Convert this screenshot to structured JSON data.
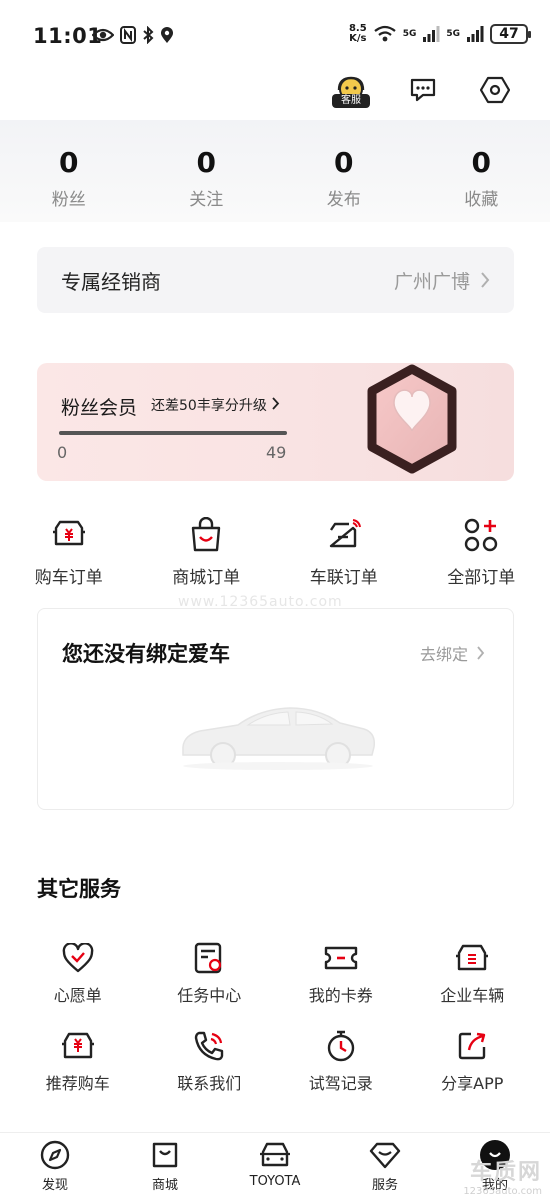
{
  "status": {
    "time": "11:01",
    "net_speed_top": "8.5",
    "net_speed_bottom": "K/s",
    "signal1": "5G",
    "signal2": "5G",
    "battery": "47"
  },
  "header": {
    "kefu_label": "客服"
  },
  "stats": [
    {
      "value": "0",
      "label": "粉丝"
    },
    {
      "value": "0",
      "label": "关注"
    },
    {
      "value": "0",
      "label": "发布"
    },
    {
      "value": "0",
      "label": "收藏"
    }
  ],
  "dealer": {
    "label": "专属经销商",
    "value": "广州广博"
  },
  "membership": {
    "title": "粉丝会员",
    "hint": "还差50丰享分升级",
    "min": "0",
    "max": "49",
    "progress_fraction": 1.0
  },
  "orders": [
    {
      "label": "购车订单",
      "icon": "car-yuan-icon"
    },
    {
      "label": "商城订单",
      "icon": "shopping-bag-icon"
    },
    {
      "label": "车联订单",
      "icon": "connected-car-icon"
    },
    {
      "label": "全部订单",
      "icon": "all-orders-icon"
    }
  ],
  "watermark": "www.12365auto.com",
  "car_binding": {
    "title": "您还没有绑定爱车",
    "action": "去绑定"
  },
  "services": {
    "title": "其它服务",
    "items": [
      {
        "label": "心愿单",
        "icon": "heart-check-icon"
      },
      {
        "label": "任务中心",
        "icon": "task-icon"
      },
      {
        "label": "我的卡券",
        "icon": "coupon-icon"
      },
      {
        "label": "企业车辆",
        "icon": "enterprise-car-icon"
      },
      {
        "label": "推荐购车",
        "icon": "recommend-car-icon"
      },
      {
        "label": "联系我们",
        "icon": "phone-icon"
      },
      {
        "label": "试驾记录",
        "icon": "stopwatch-icon"
      },
      {
        "label": "分享APP",
        "icon": "share-icon"
      }
    ]
  },
  "nav": [
    {
      "label": "发现",
      "icon": "compass-icon"
    },
    {
      "label": "商城",
      "icon": "bag-icon"
    },
    {
      "label": "TOYOTA",
      "icon": "car-front-icon"
    },
    {
      "label": "服务",
      "icon": "diamond-icon"
    },
    {
      "label": "我的",
      "icon": "avatar-icon"
    }
  ],
  "corner_watermark": {
    "big": "车质网",
    "small": "12365auto.com"
  },
  "colors": {
    "accent": "#e60012",
    "text": "#1a1a1a",
    "muted": "#8a8a8a"
  }
}
